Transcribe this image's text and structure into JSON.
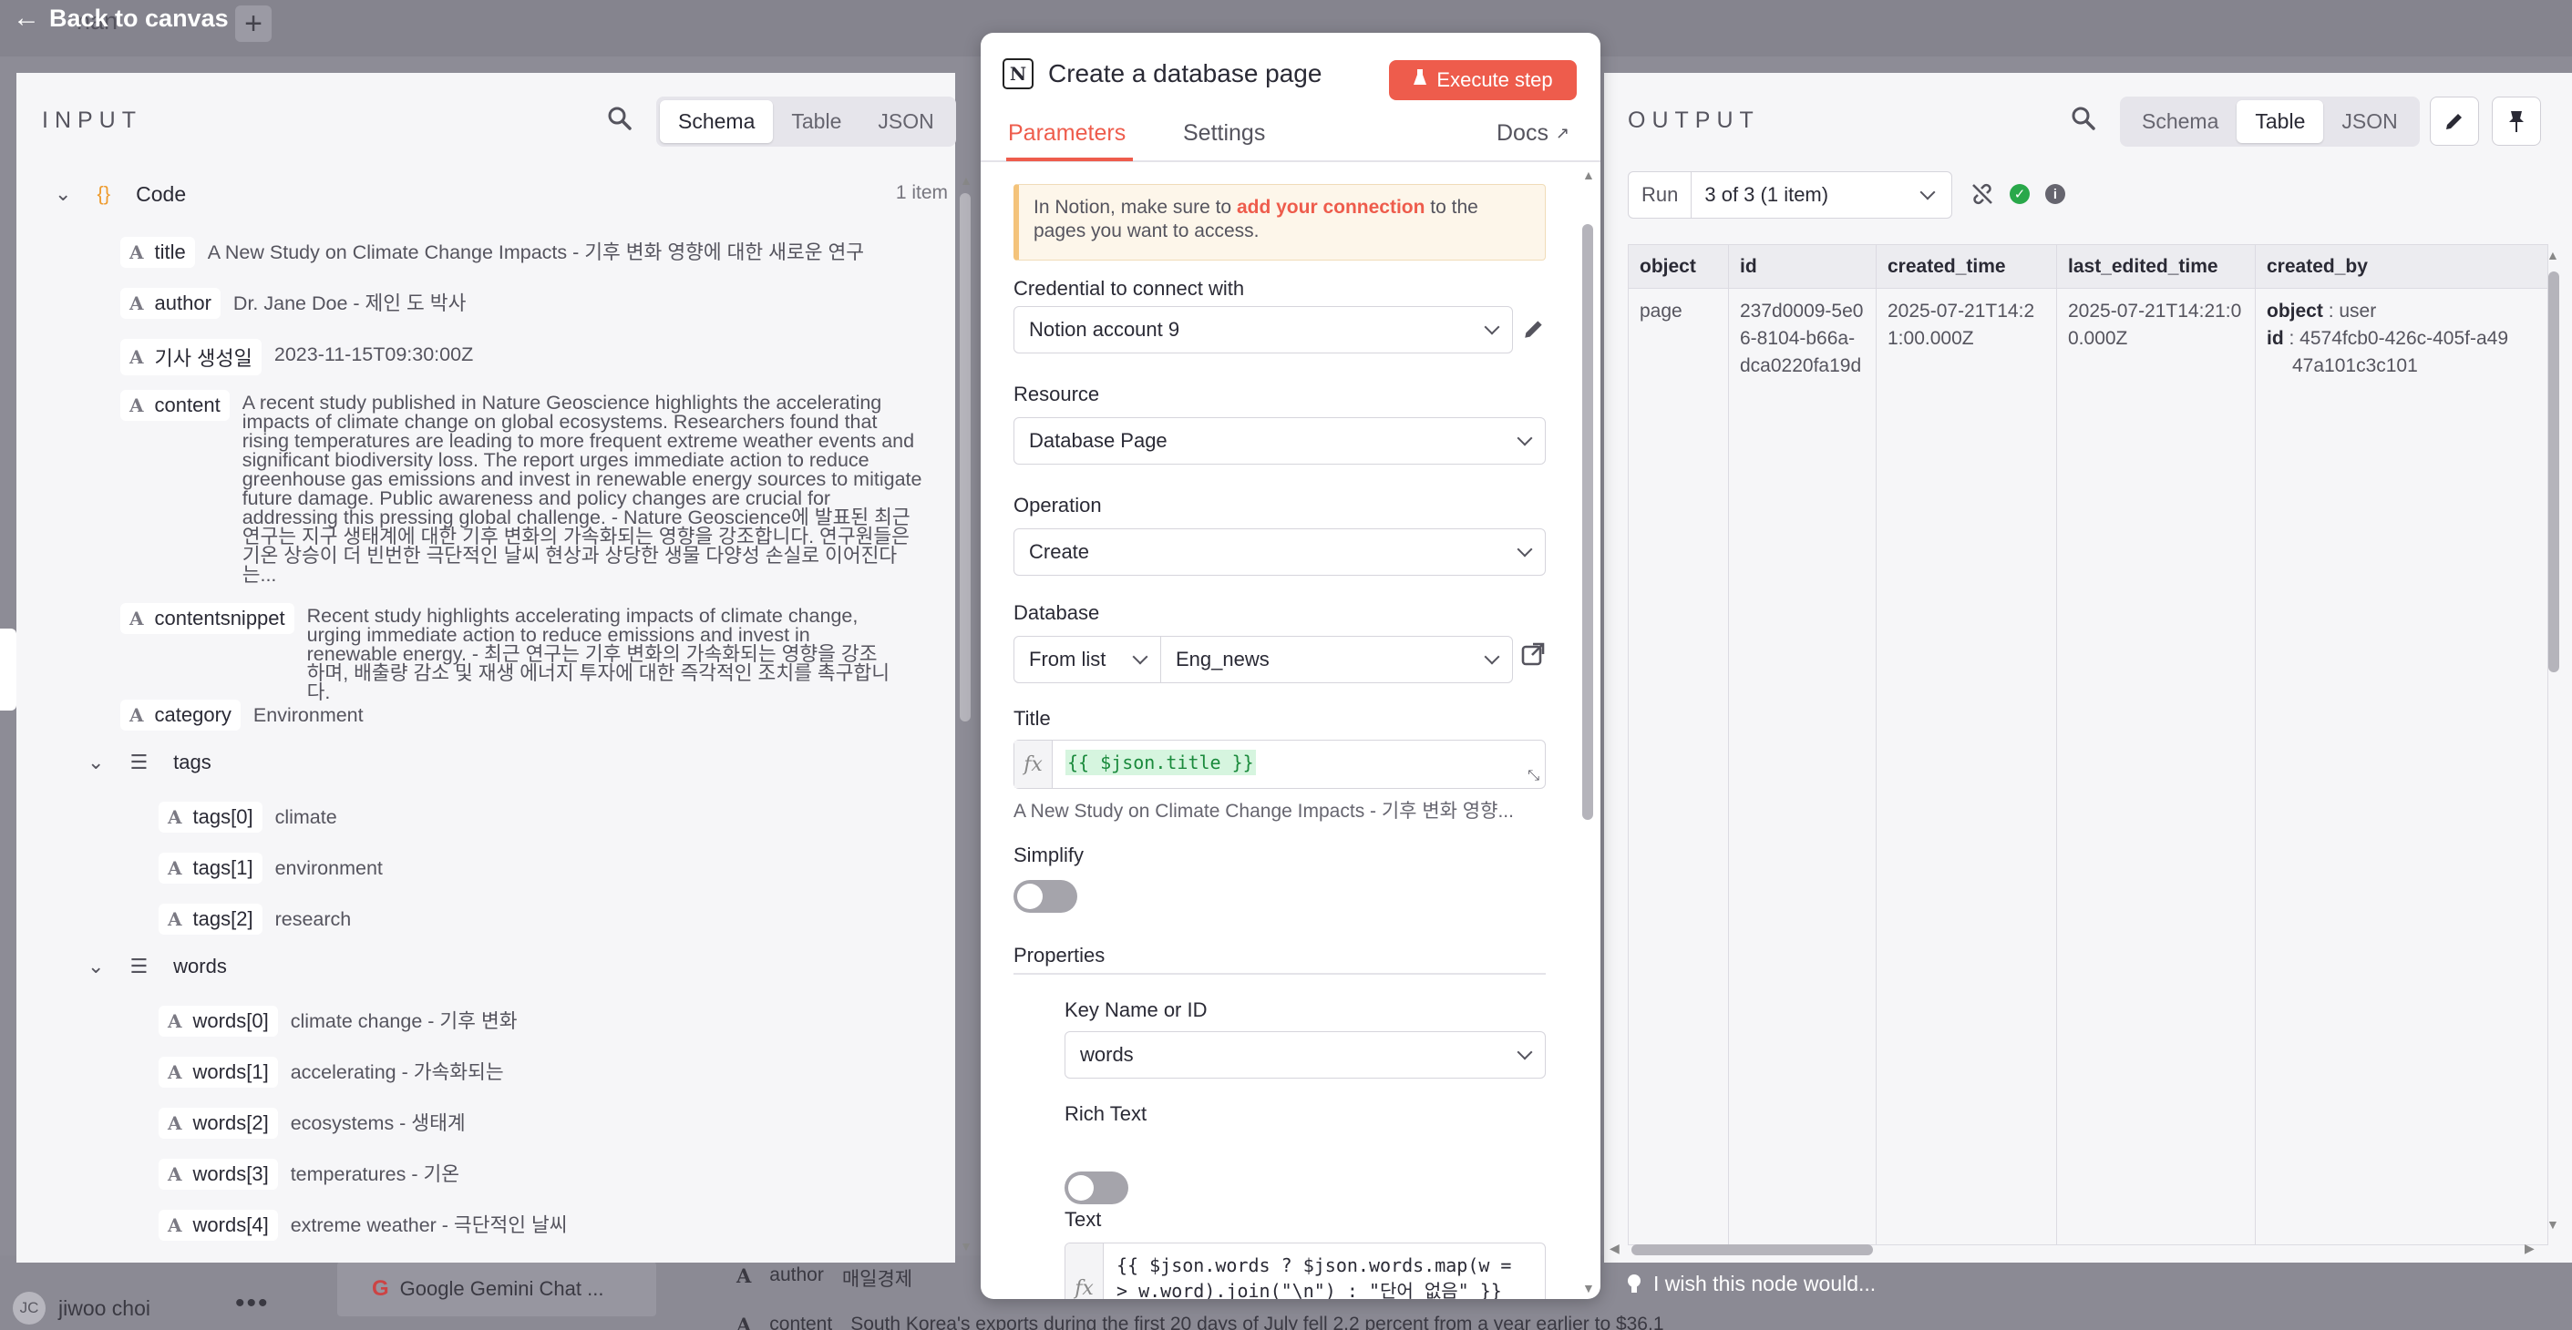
{
  "nav": {
    "back_label": "Back to canvas",
    "bg_tab_fragment": "nan",
    "add_label": "+"
  },
  "bg": {
    "user_initials": "JC",
    "user_name": "jiwoo choi",
    "more": "•••",
    "card_label": "Google Gemini Chat ...",
    "row1_key": "author",
    "row1_val": "매일경제",
    "row2_key": "content",
    "row2_val": "South Korea's exports during the first 20 days of July fell 2.2 percent from a year earlier to $36.1"
  },
  "input": {
    "title": "INPUT",
    "view_tabs": [
      "Schema",
      "Table",
      "JSON"
    ],
    "active_view": "Schema",
    "root": {
      "name": "Code",
      "count": "1 item",
      "icon": "{}"
    },
    "fields": [
      {
        "key": "title",
        "value": "A New Study on Climate Change Impacts - 기후 변화 영향에 대한 새로운 연구"
      },
      {
        "key": "author",
        "value": "Dr. Jane Doe - 제인 도 박사"
      },
      {
        "key": "기사 생성일",
        "value": "2023-11-15T09:30:00Z"
      },
      {
        "key": "content",
        "value": "A recent study published in Nature Geoscience highlights the accelerating impacts of climate change on global ecosystems. Researchers found that rising temperatures are leading to more frequent extreme weather events and significant biodiversity loss. The report urges immediate action to reduce greenhouse gas emissions and invest in renewable energy sources to mitigate future damage. Public awareness and policy changes are crucial for addressing this pressing global challenge. - Nature Geoscience에 발표된 최근 연구는 지구 생태계에 대한 기후 변화의 가속화되는 영향을 강조합니다. 연구원들은 기온 상승이 더 빈번한 극단적인 날씨 현상과 상당한 생물 다양성 손실로 이어진다는..."
      },
      {
        "key": "contentsnippet",
        "value": "Recent study highlights accelerating impacts of climate change, urging immediate action to reduce emissions and invest in renewable energy. - 최근 연구는 기후 변화의 가속화되는 영향을 강조하며, 배출량 감소 및 재생 에너지 투자에 대한 즉각적인 조치를 촉구합니다."
      },
      {
        "key": "category",
        "value": "Environment"
      }
    ],
    "tags": {
      "name": "tags",
      "items": [
        {
          "key": "tags[0]",
          "value": "climate"
        },
        {
          "key": "tags[1]",
          "value": "environment"
        },
        {
          "key": "tags[2]",
          "value": "research"
        }
      ]
    },
    "words": {
      "name": "words",
      "items": [
        {
          "key": "words[0]",
          "value": "climate change - 기후 변화"
        },
        {
          "key": "words[1]",
          "value": "accelerating - 가속화되는"
        },
        {
          "key": "words[2]",
          "value": "ecosystems - 생태계"
        },
        {
          "key": "words[3]",
          "value": "temperatures - 기온"
        },
        {
          "key": "words[4]",
          "value": "extreme weather - 극단적인 날씨"
        }
      ]
    },
    "type_glyph": "A"
  },
  "node": {
    "title": "Create a database page",
    "logo": "N",
    "execute_label": "Execute step",
    "tabs": [
      "Parameters",
      "Settings"
    ],
    "docs_label": "Docs",
    "notice_pre": "In Notion, make sure to ",
    "notice_link": "add your connection",
    "notice_post": " to the pages you want to access.",
    "credential_label": "Credential to connect with",
    "credential_value": "Notion account 9",
    "resource_label": "Resource",
    "resource_value": "Database Page",
    "operation_label": "Operation",
    "operation_value": "Create",
    "database_label": "Database",
    "database_mode": "From list",
    "database_value": "Eng_news",
    "title_label": "Title",
    "title_expr": "{{ $json.title }}",
    "title_preview": "A New Study on Climate Change Impacts - 기후 변화 영향...",
    "simplify_label": "Simplify",
    "properties_label": "Properties",
    "key_label": "Key Name or ID",
    "key_value": "words",
    "rich_text_label": "Rich Text",
    "text_label": "Text",
    "text_expr_line1": "{{ $json.words ? $json.words.map(w =",
    "text_expr_line2": "> w.word).join(\"\\n\") : \"단어 없음\" }}",
    "fx": "fx"
  },
  "output": {
    "title": "OUTPUT",
    "view_tabs": [
      "Schema",
      "Table",
      "JSON"
    ],
    "active_view": "Table",
    "run_label": "Run",
    "run_value": "3 of 3 (1 item)",
    "columns": [
      "object",
      "id",
      "created_time",
      "last_edited_time",
      "created_by"
    ],
    "row": {
      "object": "page",
      "id": "237d0009-5e06-8104-b66a-dca0220fa19d",
      "created_time": "2025-07-21T14:21:00.000Z",
      "last_edited_time": "2025-07-21T14:21:00.000Z",
      "created_by_object_key": "object",
      "created_by_object_val": ": user",
      "created_by_id_key": "id",
      "created_by_id_val": ": 4574fcb0-426c-405f-a49",
      "created_by_id_val2": "47a101c3c101"
    },
    "wish_label": "I wish this node would..."
  },
  "colors": {
    "accent": "#ee5c4c",
    "success": "#29a84a",
    "panel": "#f6f6f8"
  }
}
